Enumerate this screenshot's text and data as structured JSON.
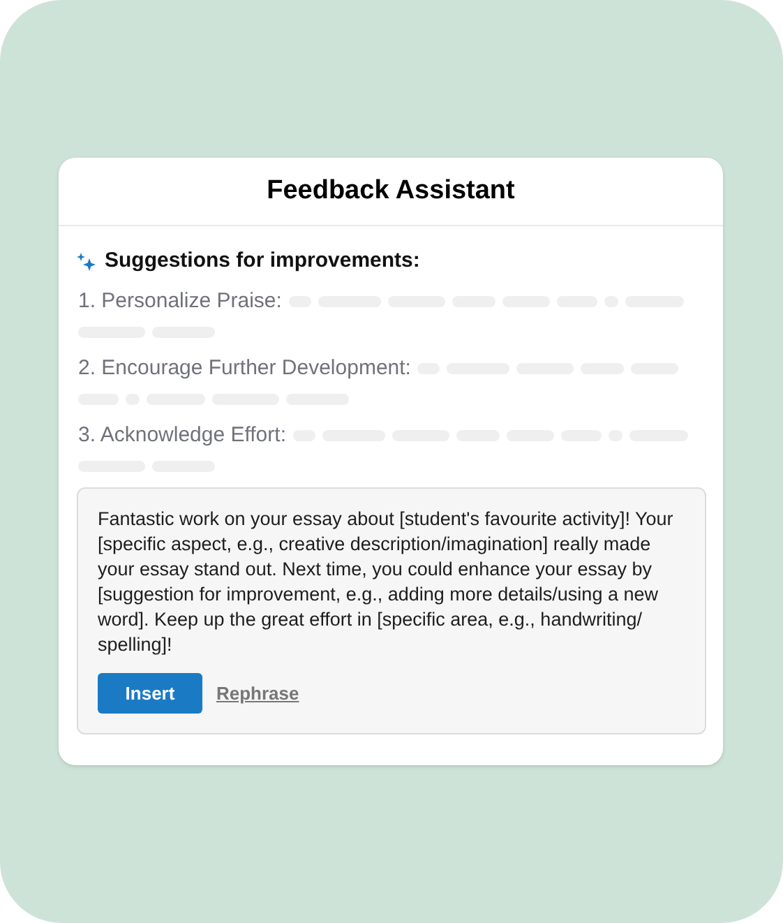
{
  "title": "Feedback Assistant",
  "suggestions": {
    "heading": "Suggestions for improvements:",
    "items": [
      {
        "label": "1. Personalize Praise:"
      },
      {
        "label": "2. Encourage Further Development:"
      },
      {
        "label": "3. Acknowledge Effort:"
      }
    ]
  },
  "message": {
    "text": "Fantastic work on your essay about [student's favourite activity]! Your [specific aspect, e.g., creative description/imagination] really made your essay stand out. Next time, you could enhance your essay by [suggestion for improvement, e.g., adding more details/using a new word]. Keep up the great effort in [specific area, e.g., handwriting/ spelling]!",
    "buttons": [
      {
        "label": "Insert",
        "kind": "primary"
      },
      {
        "label": "Rephrase",
        "kind": "link"
      }
    ]
  }
}
